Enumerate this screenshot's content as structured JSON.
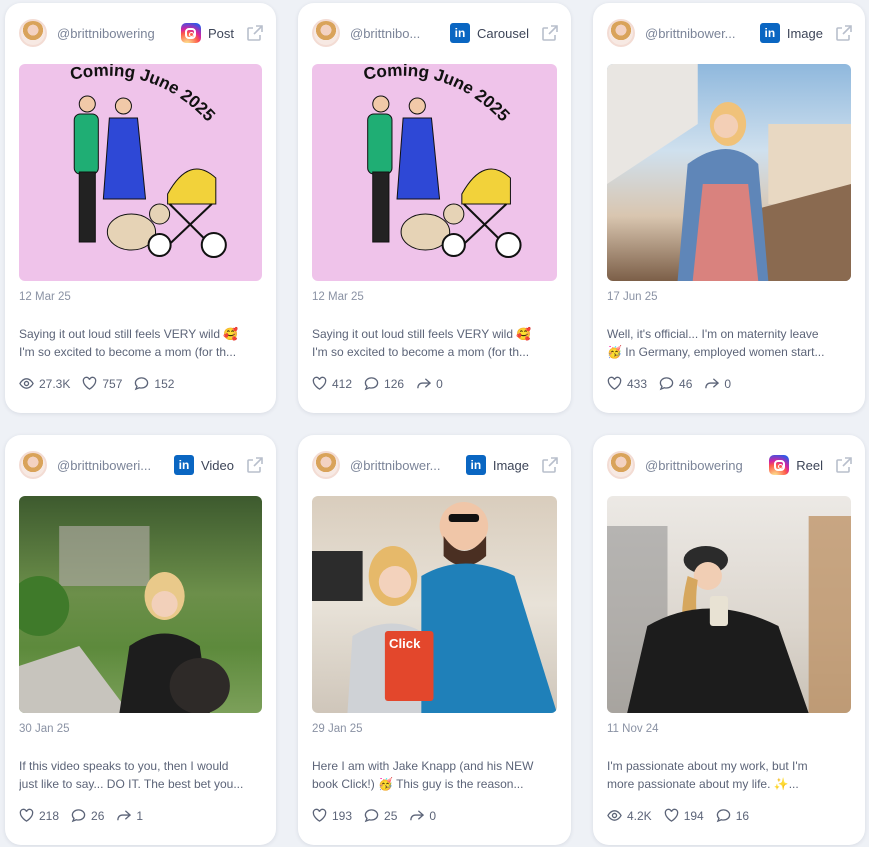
{
  "cards": [
    {
      "handle": "@brittnibowering",
      "platform": "instagram",
      "type": "Post",
      "date": "12 Mar 25",
      "caption_line1": "Saying it out loud still feels VERY wild 🥰",
      "caption_line2": "I'm so excited to become a mom (for th...",
      "stats": [
        {
          "icon": "eye-icon",
          "value": "27.3K"
        },
        {
          "icon": "heart-icon",
          "value": "757"
        },
        {
          "icon": "comment-icon",
          "value": "152"
        }
      ],
      "media_text": "Coming June 2025"
    },
    {
      "handle": "@brittnibo...",
      "platform": "linkedin",
      "type": "Carousel",
      "date": "12 Mar 25",
      "caption_line1": "Saying it out loud still feels VERY wild 🥰",
      "caption_line2": "I'm so excited to become a mom (for th...",
      "stats": [
        {
          "icon": "heart-icon",
          "value": "412"
        },
        {
          "icon": "comment-icon",
          "value": "126"
        },
        {
          "icon": "share-icon",
          "value": "0"
        }
      ],
      "media_text": "Coming June 2025"
    },
    {
      "handle": "@brittnibower...",
      "platform": "linkedin",
      "type": "Image",
      "date": "17 Jun 25",
      "caption_line1": "Well, it's official... I'm on maternity leave",
      "caption_line2": "🥳 In Germany, employed women start...",
      "stats": [
        {
          "icon": "heart-icon",
          "value": "433"
        },
        {
          "icon": "comment-icon",
          "value": "46"
        },
        {
          "icon": "share-icon",
          "value": "0"
        }
      ]
    },
    {
      "handle": "@brittniboweri...",
      "platform": "linkedin",
      "type": "Video",
      "date": "30 Jan 25",
      "caption_line1": "If this video speaks to you, then I would",
      "caption_line2": "just like to say... DO IT. The best bet you...",
      "stats": [
        {
          "icon": "heart-icon",
          "value": "218"
        },
        {
          "icon": "comment-icon",
          "value": "26"
        },
        {
          "icon": "share-icon",
          "value": "1"
        }
      ]
    },
    {
      "handle": "@brittnibower...",
      "platform": "linkedin",
      "type": "Image",
      "date": "29 Jan 25",
      "caption_line1": "Here I am with Jake Knapp (and his NEW",
      "caption_line2": "book Click!) 🥳 This guy is the reason...",
      "stats": [
        {
          "icon": "heart-icon",
          "value": "193"
        },
        {
          "icon": "comment-icon",
          "value": "25"
        },
        {
          "icon": "share-icon",
          "value": "0"
        }
      ],
      "media_text": "Click"
    },
    {
      "handle": "@brittnibowering",
      "platform": "instagram",
      "type": "Reel",
      "date": "11 Nov 24",
      "caption_line1": "I'm passionate about my work, but I'm",
      "caption_line2": "more passionate about my life. ✨...",
      "stats": [
        {
          "icon": "eye-icon",
          "value": "4.2K"
        },
        {
          "icon": "heart-icon",
          "value": "194"
        },
        {
          "icon": "comment-icon",
          "value": "16"
        }
      ]
    }
  ],
  "colors": {
    "background": "#eef1f6",
    "card": "#ffffff",
    "linkedin": "#0a66c2",
    "media_pink": "#efc3ea"
  }
}
